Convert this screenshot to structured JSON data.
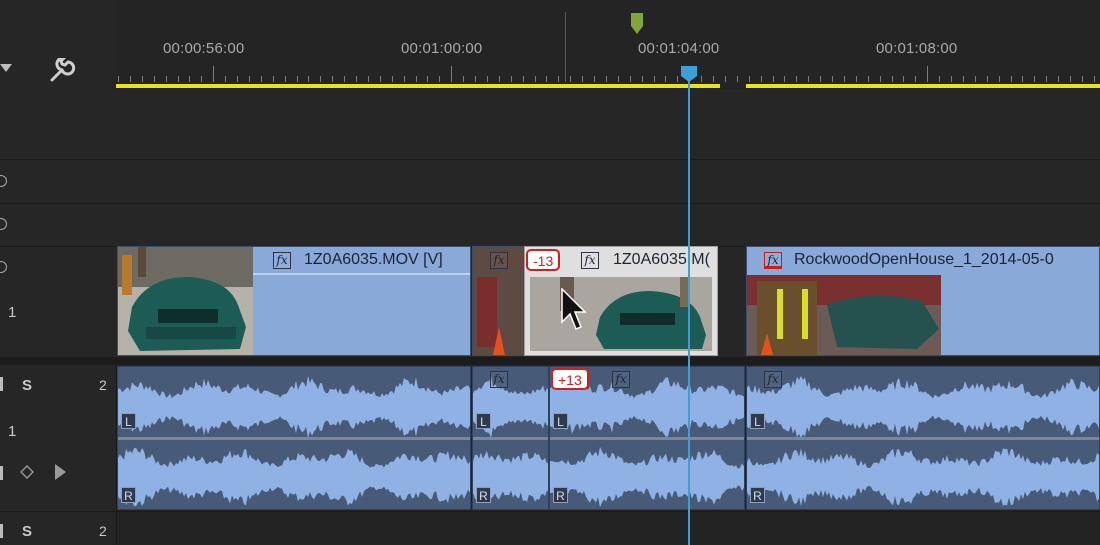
{
  "ruler": {
    "timecodes": [
      "00:00:56:00",
      "00:01:00:00",
      "00:01:04:00",
      "00:01:08:00"
    ]
  },
  "tracks": {
    "v1_label": "1",
    "a1_solo": "S",
    "a1_index": "2",
    "a1_label": "1",
    "a2_solo": "S",
    "a2_index": "2"
  },
  "video_clips": [
    {
      "name": "1Z0A6035.MOV [V]"
    },
    {
      "name": ""
    },
    {
      "name": "1Z0A6035.M("
    },
    {
      "name": "RockwoodOpenHouse_1_2014-05-0"
    }
  ],
  "audio_clips": {
    "channel_left": "L",
    "channel_right": "R"
  },
  "badges": {
    "video_offset": "-13",
    "audio_offset": "+13"
  },
  "icons": {
    "fx": "fx",
    "wrench": "wrench-icon"
  },
  "colors": {
    "work_area": "#e5e51a",
    "playhead": "#3c9fd6",
    "video_clip": "#89a9d9",
    "audio_clip": "#475b78",
    "waveform": "#8fb1e3",
    "sync_badge": "#d21e1e"
  }
}
